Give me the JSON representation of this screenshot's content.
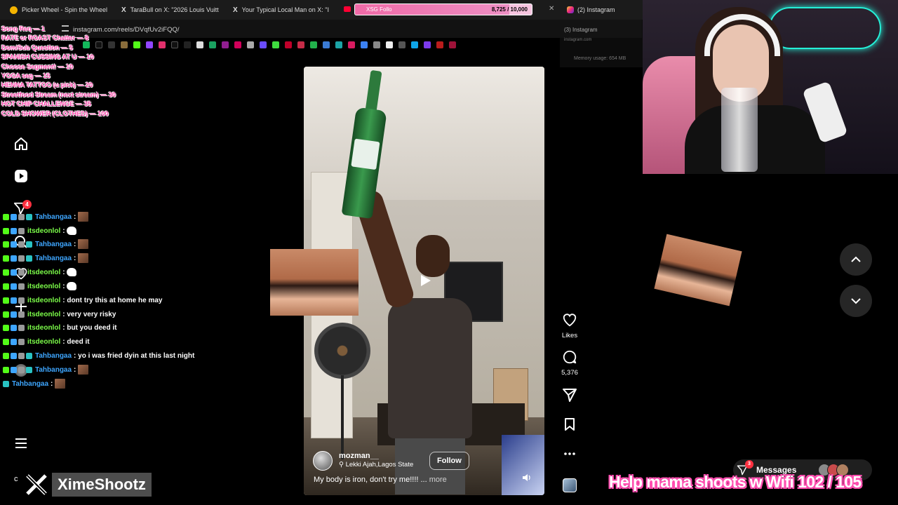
{
  "browser": {
    "tabs": [
      {
        "title": "Picker Wheel - Spin the Wheel",
        "color": "#f5b400"
      },
      {
        "title": "TaraBull on X: \"2026 Louis Vuitt",
        "color": "#ffffff"
      },
      {
        "title": "Your Typical Local Man on X: \"I",
        "color": "#ffffff"
      }
    ],
    "last_tab_title": "(2) Instagram",
    "url": "instagram.com/reels/DVqfUv2iFQQ/"
  },
  "goal_bar": {
    "label": "XSG Follo",
    "count": "8,725 / 10,000",
    "progress": 0.8725
  },
  "menu": [
    "Song Req — 1",
    "RATE or ROAST Chatter — 8",
    "Dom/Sub Question — 5",
    "SPANISH CUSSING AT U — 10",
    "Choose Segment! — 10",
    "YOGA seg — 15",
    "HENNA TATTOO (u pick) — 20",
    "Streetfood Stream (next stream) — 30",
    "HOT CHIP CHALLENGE — 35",
    "COLD SHOWER (CLOTHED) — 100"
  ],
  "notifications_count": "4",
  "chat": [
    {
      "user": "Tahbangaa",
      "color": "#3ea6ff",
      "msg": "",
      "emote": "face"
    },
    {
      "user": "itsdeonlol",
      "color": "#7dff4a",
      "msg": "",
      "emote": "white"
    },
    {
      "user": "Tahbangaa",
      "color": "#3ea6ff",
      "msg": "",
      "emote": "face"
    },
    {
      "user": "Tahbangaa",
      "color": "#3ea6ff",
      "msg": "",
      "emote": "face"
    },
    {
      "user": "itsdeonlol",
      "color": "#7dff4a",
      "msg": "",
      "emote": "white"
    },
    {
      "user": "itsdeonlol",
      "color": "#7dff4a",
      "msg": "",
      "emote": "white"
    },
    {
      "user": "itsdeonlol",
      "color": "#7dff4a",
      "msg": "dont try this at home he may",
      "emote": ""
    },
    {
      "user": "itsdeonlol",
      "color": "#7dff4a",
      "msg": "very very risky",
      "emote": ""
    },
    {
      "user": "itsdeonlol",
      "color": "#7dff4a",
      "msg": "but you deed it",
      "emote": ""
    },
    {
      "user": "itsdeonlol",
      "color": "#7dff4a",
      "msg": "deed it",
      "emote": ""
    },
    {
      "user": "Tahbangaa",
      "color": "#3ea6ff",
      "msg": "yo i was fried dyin at this last night",
      "emote": ""
    },
    {
      "user": "Tahbangaa",
      "color": "#3ea6ff",
      "msg": "",
      "emote": "face"
    },
    {
      "user": "Tahbangaa",
      "color": "#3ea6ff",
      "msg": "",
      "emote": "face"
    }
  ],
  "reel": {
    "username": "mozman__",
    "location": "Lekki Ajah,Lagos State",
    "follow_label": "Follow",
    "caption": "My body is iron, don't try me!!!! ...",
    "more_label": "more"
  },
  "actions": {
    "likes_label": "Likes",
    "comments_count": "5,376"
  },
  "mini_window": {
    "title": "(3) Instagram",
    "url": "instagram.com",
    "memory": "Memory usage: 654 MB"
  },
  "messages": {
    "label": "Messages",
    "badge": "3"
  },
  "brand": {
    "name": "XimeShootz",
    "letter": "c"
  },
  "goal_text": "Help mama shoots w Wifi  102 / 105",
  "colors": {
    "accent_pink": "#ff4fb0",
    "instagram_red": "#ff3040",
    "neon_teal": "#25f0d8"
  }
}
